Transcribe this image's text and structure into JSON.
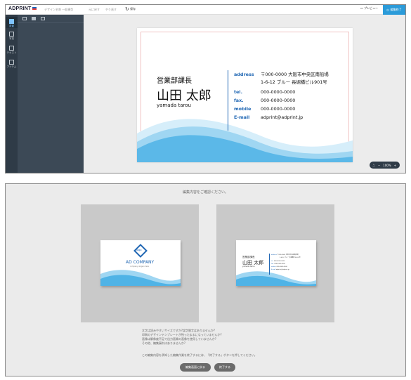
{
  "editor": {
    "brand": "ADPRINT",
    "toolbar": {
      "design_title": "デザイン名刺 一般横型",
      "undo": "元に戻す",
      "redo": "やり直す",
      "save": "保存",
      "preview": "プレビュー",
      "finish": "編集終了"
    },
    "rail": [
      {
        "label": "背景"
      },
      {
        "label": "写真"
      },
      {
        "label": "テキスト"
      },
      {
        "label": "アイテム"
      }
    ],
    "zoom": "100%"
  },
  "card": {
    "title": "営業部課長",
    "name": "山田 太郎",
    "romaji": "yamada tarou",
    "address_label": "address",
    "address_line1": "〒000-0000 大阪市中央区南船場",
    "address_line2": "1-6-12 ブルー 長堀橋ビル901号",
    "tel_label": "tel.",
    "tel": "000-0000-0000",
    "fax_label": "fax.",
    "fax": "000-0000-0000",
    "mobile_label": "mobile",
    "mobile": "000-0000-0000",
    "email_label": "E-mail",
    "email": "adprint@adprint.jp",
    "accent": "#1f66b3",
    "wave_colors": [
      "#4fb3e6",
      "#9fd6f2",
      "#d6eefa"
    ]
  },
  "confirm": {
    "heading": "編集内容をご確認ください。",
    "front": {
      "logo_text": "logo",
      "company": "AD COMPANY",
      "tagline": "company slogan here"
    },
    "checklist": [
      "文字は読みやすいサイズですか?誤字脱字はありませんか?",
      "印刷のデザインテンプレートが残ったままになっていませんか?",
      "画像は解像度不足で出力画質の画像を使用していませんか?",
      "その他、編集漏れはありませんか?"
    ],
    "note": "この編集内容を承知した編集作業を終了するには、「終了する」ボタンを押してください。",
    "back_button": "編集画面に戻る",
    "finish_button": "終了する"
  }
}
